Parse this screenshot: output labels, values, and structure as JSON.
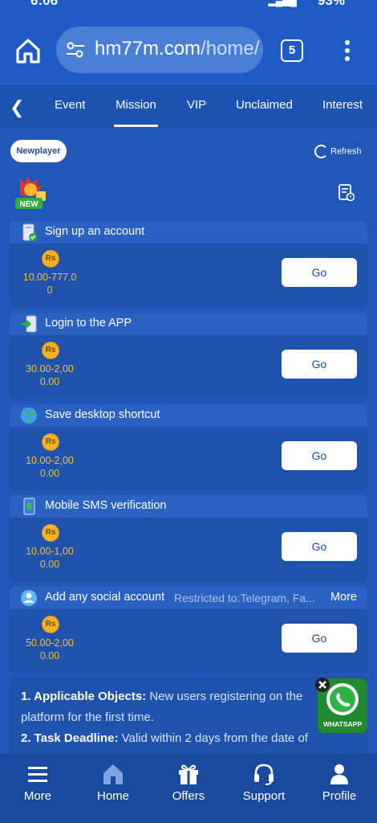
{
  "status": {
    "time": "6:06",
    "battery": "93%"
  },
  "browser": {
    "url_host": "hm77m.com",
    "url_path": "/home/",
    "tab_count": "5"
  },
  "nav_tabs": [
    "Event",
    "Mission",
    "VIP",
    "Unclaimed",
    "Interest"
  ],
  "active_tab": "Mission",
  "filter": {
    "chip": "Newplayer",
    "refresh": "Refresh",
    "badge": "NEW"
  },
  "currency_symbol": "Rs",
  "tasks": [
    {
      "title": "Sign up an account",
      "amount_line1": "10.00-777.0",
      "amount_line2": "0",
      "action": "Go",
      "icon": "phone-check-icon"
    },
    {
      "title": "Login to the APP",
      "amount_line1": "30.00-2,00",
      "amount_line2": "0.00",
      "action": "Go",
      "icon": "login-arrow-icon"
    },
    {
      "title": "Save desktop shortcut",
      "amount_line1": "10.00-2,00",
      "amount_line2": "0.00",
      "action": "Go",
      "icon": "globe-icon"
    },
    {
      "title": "Mobile SMS verification",
      "amount_line1": "10.00-1,00",
      "amount_line2": "0.00",
      "action": "Go",
      "icon": "phone-shield-icon"
    },
    {
      "title": "Add any social account",
      "restriction": "Restricted to:Telegram, Fa...",
      "more": "More",
      "amount_line1": "50.00-2,00",
      "amount_line2": "0.00",
      "action": "Go",
      "icon": "social-icon"
    }
  ],
  "rules": {
    "item1_label": "1. Applicable Objects:",
    "item1_text": " New users registering on the platform for the first time.",
    "item2_label": "2. Task Deadline:",
    "item2_text": " Valid within 2 days from the date of"
  },
  "whatsapp": {
    "label": "WHATSAPP"
  },
  "bottom_nav": [
    "More",
    "Home",
    "Offers",
    "Support",
    "Profile"
  ],
  "colors": {
    "page_bg": "#2158b8",
    "accent_gold": "#f3c236",
    "header_blue": "#1f5bc4"
  }
}
